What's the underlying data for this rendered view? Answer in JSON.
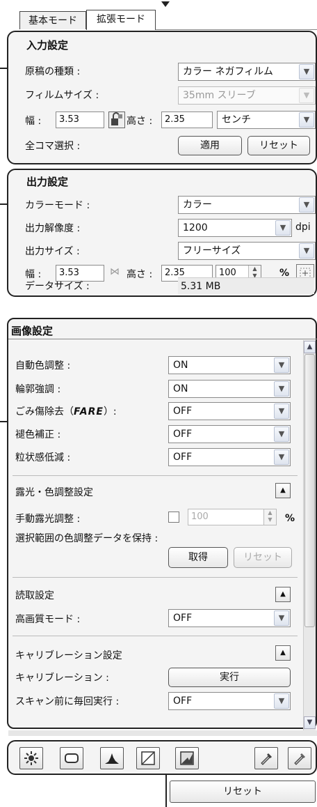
{
  "tabs": {
    "basic": "基本モード",
    "advanced": "拡張モード"
  },
  "input_settings": {
    "title": "入力設定",
    "original_type_label": "原稿の種類 :",
    "original_type_value": "カラー ネガフィルム",
    "film_size_label": "フィルムサイズ :",
    "film_size_value": "35mm スリーブ",
    "width_label": "幅 :",
    "width_value": "3.53",
    "height_label": "高さ :",
    "height_value": "2.35",
    "unit_value": "センチ",
    "select_all_label": "全コマ選択 :",
    "apply_button": "適用",
    "reset_button": "リセット"
  },
  "output_settings": {
    "title": "出力設定",
    "color_mode_label": "カラーモード :",
    "color_mode_value": "カラー",
    "resolution_label": "出力解像度 :",
    "resolution_value": "1200",
    "resolution_unit": "dpi",
    "output_size_label": "出力サイズ :",
    "output_size_value": "フリーサイズ",
    "width_label": "幅 :",
    "width_value": "3.53",
    "height_label": "高さ :",
    "height_value": "2.35",
    "scale_value": "100",
    "scale_unit": "%",
    "data_size_label": "データサイズ :",
    "data_size_value": "5.31 MB"
  },
  "image_settings": {
    "title": "画像設定",
    "auto_color_label": "自動色調整 :",
    "auto_color_value": "ON",
    "sharpen_label": "輪郭強調 :",
    "sharpen_value": "ON",
    "dust_label_prefix": "ごみ傷除去（",
    "dust_label_brand": "FARE",
    "dust_label_suffix": "）:",
    "dust_value": "OFF",
    "fade_label": "褪色補正 :",
    "fade_value": "OFF",
    "grain_label": "粒状感低減 :",
    "grain_value": "OFF",
    "exposure_section_title": "露光・色調整設定",
    "manual_exposure_label": "手動露光調整 :",
    "manual_exposure_value": "100",
    "manual_exposure_unit": "%",
    "keep_color_data_label": "選択範囲の色調整データを保持 :",
    "acquire_button": "取得",
    "reset_button": "リセット",
    "scan_section_title": "読取設定",
    "quality_label": "高画質モード :",
    "quality_value": "OFF",
    "calibration_section_title": "キャリブレーション設定",
    "calibration_label": "キャリブレーション :",
    "calibration_button": "実行",
    "calib_before_scan_label": "スキャン前に毎回実行 :",
    "calib_before_scan_value": "OFF"
  },
  "toolbar": {
    "icons": [
      "brightness-icon",
      "saturation-icon",
      "histogram-icon",
      "tone-curve-icon",
      "final-review-icon",
      "threshold-icon",
      "eyedropper-icon"
    ]
  },
  "footer": {
    "reset_button": "リセット"
  },
  "colors": {
    "border": "#222222",
    "panel": "#f4f4f4",
    "accent_arrow": "#dfe5ef"
  }
}
